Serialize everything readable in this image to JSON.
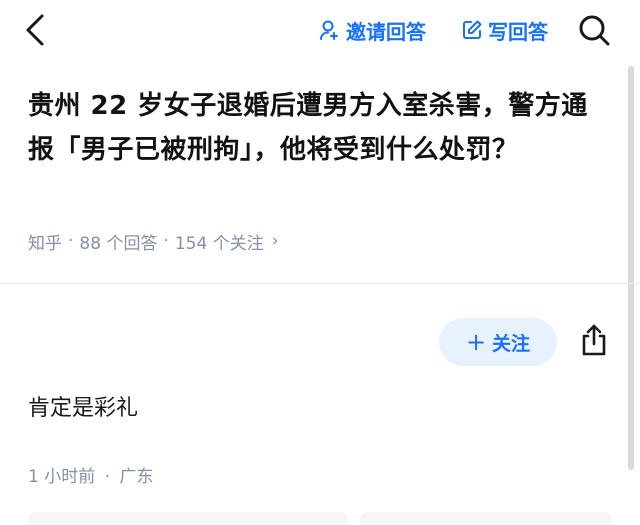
{
  "nav": {
    "invite_label": "邀请回答",
    "write_label": "写回答",
    "icons": {
      "back": "chevron-left-icon",
      "invite": "person-add-icon",
      "write": "edit-icon",
      "search": "search-icon"
    },
    "accent_color": "#1772f6"
  },
  "question": {
    "title": "贵州 22 岁女子退婚后遭男方入室杀害，警方通报「男子已被刑拘」，他将受到什么处罚？",
    "source": "知乎",
    "answers": "88 个回答",
    "followers": "154 个关注",
    "separator": "·",
    "chevron": "›"
  },
  "answer": {
    "follow_plus": "+",
    "follow_label": "关注",
    "content": "肯定是彩礼",
    "time": "1 小时前",
    "location": "广东",
    "separator": "·"
  }
}
